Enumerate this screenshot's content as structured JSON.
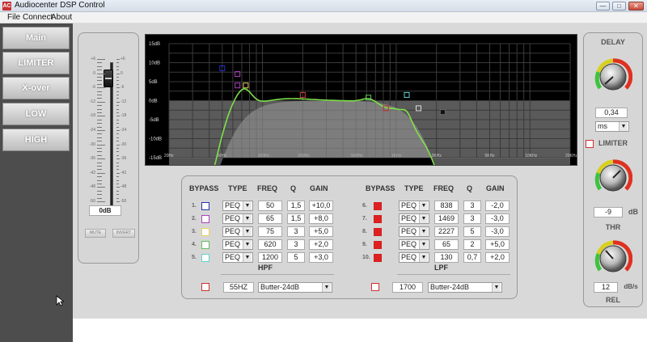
{
  "window": {
    "title": "Audiocenter DSP Control",
    "app_icon": "audiocenter-app-icon",
    "controls": [
      "minimize",
      "maximize",
      "close"
    ]
  },
  "menu": [
    "File",
    "Connect",
    "About"
  ],
  "nav": [
    "Main",
    "LIMITER",
    "X-over",
    "LOW",
    "HIGH"
  ],
  "fader": {
    "scale_left": [
      "+6",
      "0",
      "-6",
      "-12",
      "-18",
      "-24",
      "-30",
      "-36",
      "-42",
      "-48",
      "-50"
    ],
    "scale_right": [
      "+6",
      "0",
      "-6",
      "-12",
      "-18",
      "-24",
      "-30",
      "-36",
      "-42",
      "-48",
      "-50"
    ],
    "value": "0dB",
    "mute_label": "MUTE",
    "invert_label": "INVERT"
  },
  "graph": {
    "y_labels": [
      "15dB",
      "10dB",
      "5dB",
      "0dB",
      "-5dB",
      "-10dB",
      "-15dB"
    ],
    "x_labels": [
      "20Hz",
      "50Hz",
      "100Hz",
      "200Hz",
      "500Hz",
      "1KHz",
      "2KHz",
      "5KHz",
      "10KHz",
      "20KHz"
    ]
  },
  "eq_left": {
    "headers": [
      "BYPASS",
      "TYPE",
      "FREQ",
      "Q",
      "GAIN"
    ],
    "rows": [
      {
        "n": "1.",
        "type": "PEQ",
        "freq": "50",
        "q": "1,5",
        "gain": "+10,0",
        "color": "#2233aa"
      },
      {
        "n": "2.",
        "type": "PEQ",
        "freq": "65",
        "q": "1,5",
        "gain": "+8,0",
        "color": "#b040c0"
      },
      {
        "n": "3.",
        "type": "PEQ",
        "freq": "75",
        "q": "3",
        "gain": "+5,0",
        "color": "#e8d060"
      },
      {
        "n": "4.",
        "type": "PEQ",
        "freq": "620",
        "q": "3",
        "gain": "+2,0",
        "color": "#60c060"
      },
      {
        "n": "5.",
        "type": "PEQ",
        "freq": "1200",
        "q": "5",
        "gain": "+3,0",
        "color": "#60d0d0"
      }
    ],
    "filter_label": "HPF",
    "filter_freq": "55HZ",
    "filter_type": "Butter-24dB"
  },
  "eq_right": {
    "headers": [
      "BYPASS",
      "TYPE",
      "FREQ",
      "Q",
      "GAIN"
    ],
    "rows": [
      {
        "n": "6.",
        "type": "PEQ",
        "freq": "838",
        "q": "3",
        "gain": "-2,0"
      },
      {
        "n": "7.",
        "type": "PEQ",
        "freq": "1469",
        "q": "3",
        "gain": "-3,0"
      },
      {
        "n": "8.",
        "type": "PEQ",
        "freq": "2227",
        "q": "5",
        "gain": "-3,0"
      },
      {
        "n": "9.",
        "type": "PEQ",
        "freq": "65",
        "q": "2",
        "gain": "+5,0"
      },
      {
        "n": "10.",
        "type": "PEQ",
        "freq": "130",
        "q": "0,7",
        "gain": "+2,0"
      }
    ],
    "filter_label": "LPF",
    "filter_freq": "1700",
    "filter_type": "Butter-24dB"
  },
  "right": {
    "delay_label": "DELAY",
    "delay_value": "0,34",
    "delay_unit": "ms",
    "limiter_label": "LIMITER",
    "thr_value": "-9",
    "thr_unit": "dB",
    "thr_label": "THR",
    "rel_value": "12",
    "rel_unit": "dB/s",
    "rel_label": "REL"
  },
  "colors": {
    "nav_bg": "#4d4d4d",
    "curve": "#7ee04a",
    "grid": "#444",
    "accent_red": "#e02020"
  }
}
